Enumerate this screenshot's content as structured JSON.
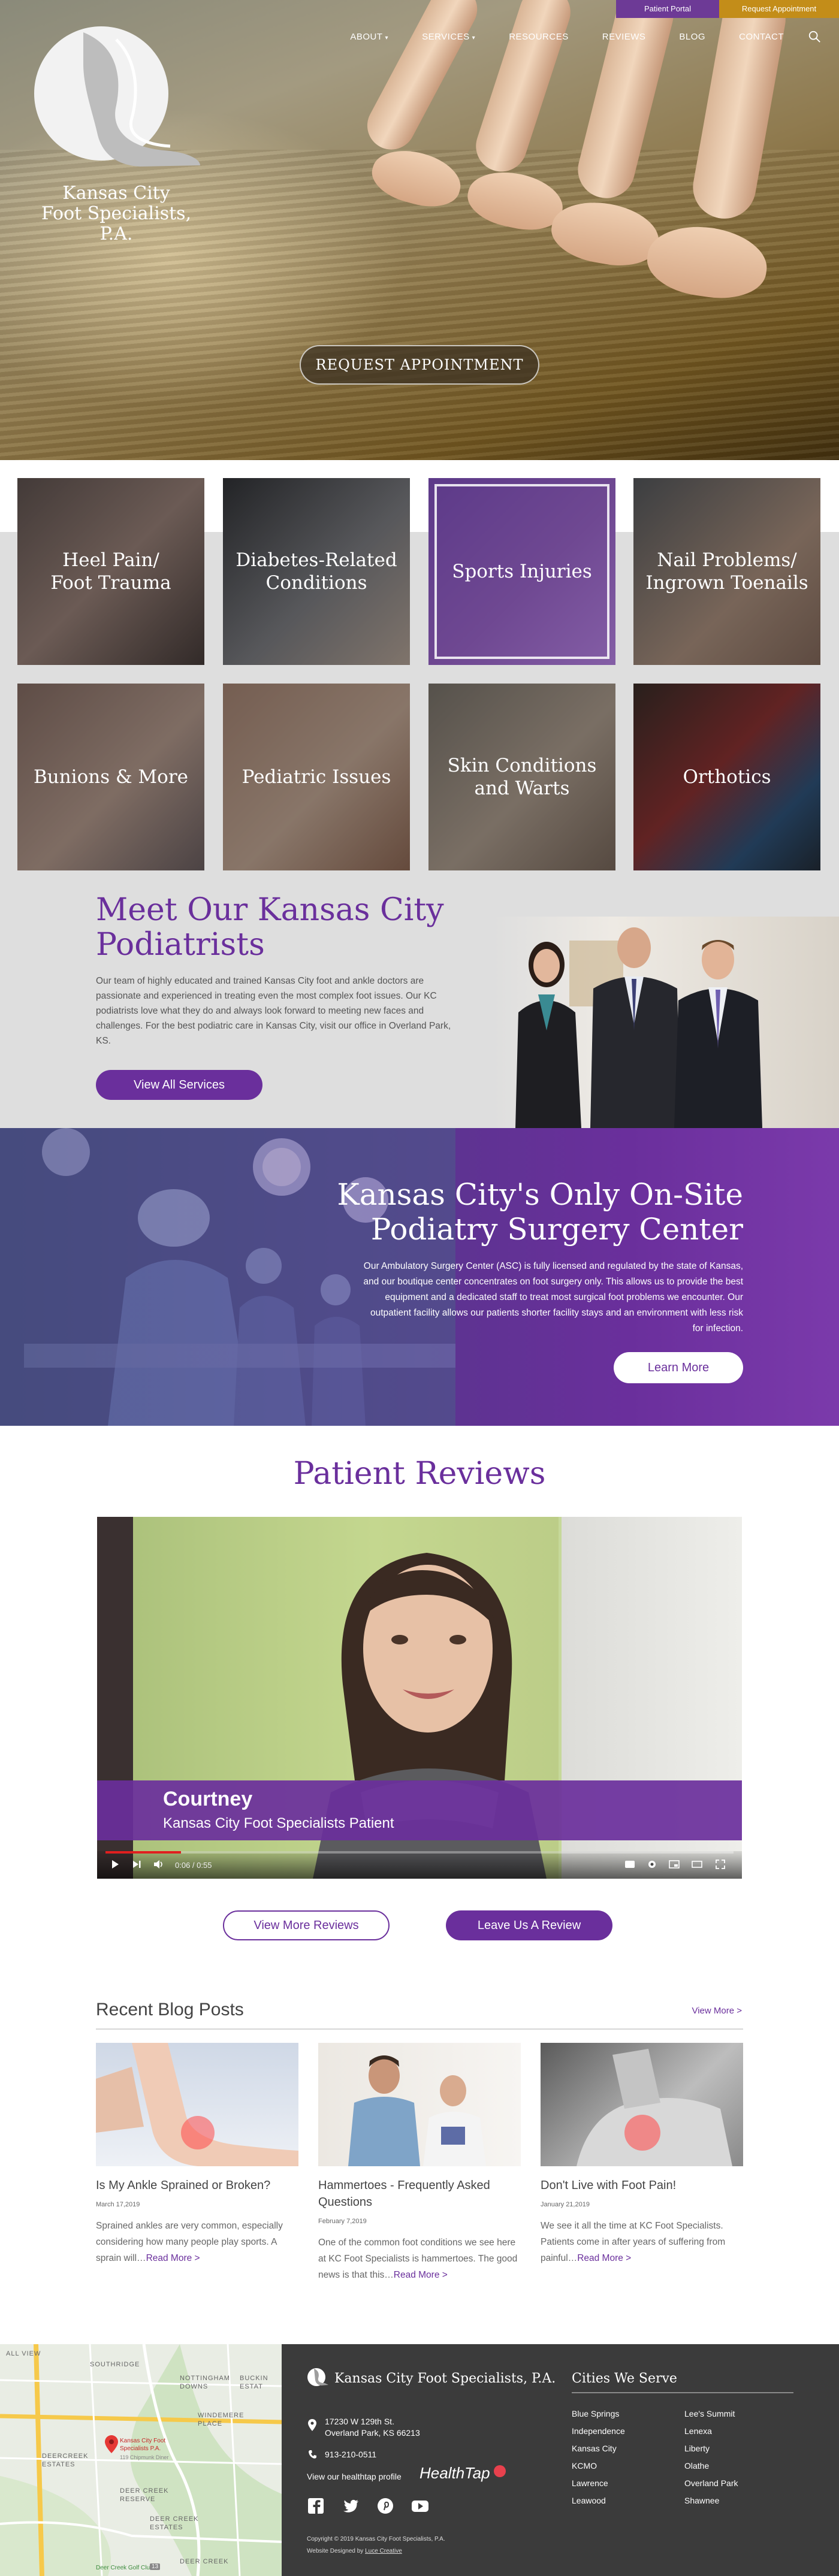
{
  "topbar": {
    "patient_portal": "Patient Portal",
    "request_appointment": "Request Appointment"
  },
  "nav": {
    "items": [
      "ABOUT",
      "SERVICES",
      "RESOURCES",
      "REVIEWS",
      "BLOG",
      "CONTACT"
    ],
    "caret": "▾"
  },
  "logo": {
    "line1": "Kansas City",
    "line2": "Foot Specialists, P.A."
  },
  "hero": {
    "cta": "REQUEST APPOINTMENT"
  },
  "services": [
    {
      "line1": "Heel Pain/",
      "line2": "Foot Trauma"
    },
    {
      "line1": "Diabetes-Related",
      "line2": "Conditions"
    },
    {
      "line1": "Sports Injuries",
      "line2": ""
    },
    {
      "line1": "Nail Problems/",
      "line2": "Ingrown Toenails"
    },
    {
      "line1": "Bunions & More",
      "line2": ""
    },
    {
      "line1": "Pediatric Issues",
      "line2": ""
    },
    {
      "line1": "Skin Conditions",
      "line2": "and Warts"
    },
    {
      "line1": "Orthotics",
      "line2": ""
    }
  ],
  "meet": {
    "title_line1": "Meet Our Kansas City",
    "title_line2": "Podiatrists",
    "body": "Our team of highly educated and trained Kansas City foot and ankle doctors are passionate and experienced in treating even the most complex foot issues. Our KC podiatrists love what they do and always look forward to meeting new faces and challenges. For the best podiatric care in Kansas City, visit our office in Overland Park, KS.",
    "button": "View All Services"
  },
  "surgery": {
    "title_line1": "Kansas City's Only On-Site",
    "title_line2": "Podiatry Surgery Center",
    "body": "Our Ambulatory Surgery Center (ASC) is fully licensed and regulated by the state of Kansas, and our boutique center concentrates on foot surgery only. This allows us to provide the best equipment and a dedicated staff to treat most surgical foot problems we encounter. Our outpatient facility allows our patients shorter facility stays and an environment with less risk for infection.",
    "button": "Learn More"
  },
  "reviews": {
    "title": "Patient Reviews",
    "video": {
      "name": "Courtney",
      "role": "Kansas City Foot Specialists Patient",
      "time": "0:06 / 0:55",
      "progress": 0.12
    },
    "view_more": "View More Reviews",
    "leave": "Leave Us A Review"
  },
  "blog": {
    "title": "Recent Blog Posts",
    "view_more": "View More >",
    "posts": [
      {
        "title": "Is My Ankle Sprained or Broken?",
        "date": "March 17,2019",
        "excerpt": "Sprained ankles are very common, especially considering how many people play sports. A sprain will…",
        "read_more": "Read More >"
      },
      {
        "title": "Hammertoes - Frequently Asked Questions",
        "date": "February 7,2019",
        "excerpt": "One of the common foot conditions we see here at KC Foot Specialists is hammertoes. The good news is that this…",
        "read_more": "Read More >"
      },
      {
        "title": "Don't Live with Foot Pain!",
        "date": "January 21,2019",
        "excerpt": "We see it all the time at KC Foot Specialists. Patients come in after years of suffering from painful…",
        "read_more": "Read More >"
      }
    ]
  },
  "footer": {
    "brand": "Kansas City Foot Specialists, P.A.",
    "address_line1": "17230 W 129th St.",
    "address_line2": "Overland Park, KS 66213",
    "phone": "913-210-0511",
    "healthtap_label": "View our healthtap profile",
    "healthtap_logo": "HealthTap",
    "copyright": "Copyright © 2019 Kansas City Foot Specialists, P.A.",
    "designed_prefix": "Website Designed by",
    "designed_by": "Luce Creative",
    "cities_title": "Cities We Serve",
    "cities_col1": [
      "Blue Springs",
      "Independence",
      "Kansas City",
      "KCMO",
      "Lawrence",
      "Leawood"
    ],
    "cities_col2": [
      "Lee's Summit",
      "Lenexa",
      "Liberty",
      "Olathe",
      "Overland Park",
      "Shawnee"
    ]
  },
  "map": {
    "labels": [
      "ALL VIEW",
      "SOUTHRIDGE",
      "NOTTINGHAM DOWNS",
      "BUCKIN ESTAT",
      "WINDEMERE PLACE",
      "DEERCREEK ESTATES",
      "DEER CREEK RESERVE",
      "DEER CREEK ESTATES",
      "DEER CREEK"
    ],
    "pin_label": "Kansas City Foot Specialists P.A.",
    "pin_sub": "119 Chipmunk Diner",
    "golf": "Deer Creek Golf Club",
    "road": "13"
  },
  "colors": {
    "brand_purple": "#6a2f9c",
    "gold": "#c38d19",
    "footer_dark": "#3b3b3b",
    "band_gray": "#dedede",
    "youtube_red": "#e01f1f"
  },
  "icons": [
    "search-icon",
    "play-icon",
    "next-icon",
    "volume-icon",
    "captions-icon",
    "settings-icon",
    "miniplayer-icon",
    "theater-icon",
    "fullscreen-icon",
    "map-pin-icon",
    "phone-icon",
    "facebook-icon",
    "twitter-icon",
    "pinterest-icon",
    "youtube-icon"
  ]
}
